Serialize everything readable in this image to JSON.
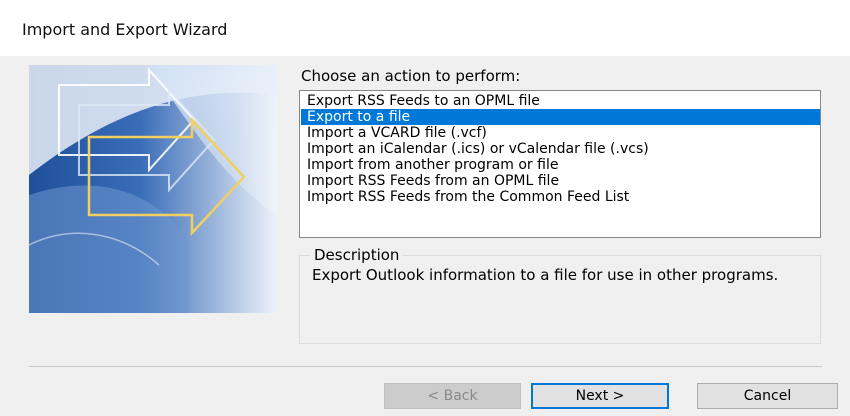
{
  "window": {
    "title": "Import and Export Wizard"
  },
  "prompt": "Choose an action to perform:",
  "actions": [
    {
      "label": "Export RSS Feeds to an OPML file",
      "selected": false
    },
    {
      "label": "Export to a file",
      "selected": true
    },
    {
      "label": "Import a VCARD file (.vcf)",
      "selected": false
    },
    {
      "label": "Import an iCalendar (.ics) or vCalendar file (.vcs)",
      "selected": false
    },
    {
      "label": "Import from another program or file",
      "selected": false
    },
    {
      "label": "Import RSS Feeds from an OPML file",
      "selected": false
    },
    {
      "label": "Import RSS Feeds from the Common Feed List",
      "selected": false
    }
  ],
  "description": {
    "legend": "Description",
    "text": "Export Outlook information to a file for use in other programs."
  },
  "buttons": {
    "back": "< Back",
    "next": "Next >",
    "cancel": "Cancel"
  },
  "colors": {
    "selection": "#0078d7",
    "art_blue": "#2a5ea8",
    "art_arrow": "#f2d060"
  },
  "icons": {
    "wizard_art": "wizard-arrows-graphic"
  }
}
